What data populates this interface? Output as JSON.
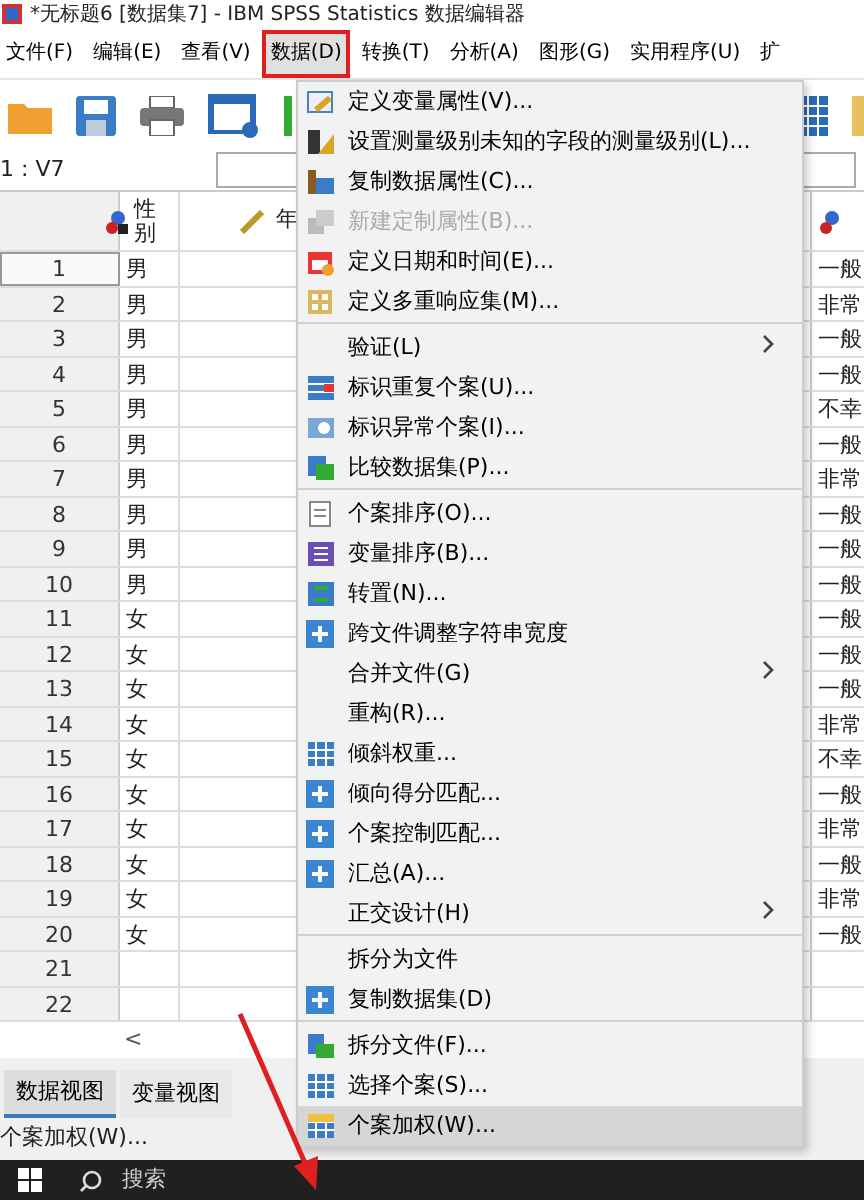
{
  "window": {
    "title": "*无标题6 [数据集7] - IBM SPSS Statistics 数据编辑器"
  },
  "menubar": [
    {
      "label": "文件(F)",
      "selected": false
    },
    {
      "label": "编辑(E)",
      "selected": false
    },
    {
      "label": "查看(V)",
      "selected": false
    },
    {
      "label": "数据(D)",
      "selected": true
    },
    {
      "label": "转换(T)",
      "selected": false
    },
    {
      "label": "分析(A)",
      "selected": false
    },
    {
      "label": "图形(G)",
      "selected": false
    },
    {
      "label": "实用程序(U)",
      "selected": false
    },
    {
      "label": "扩",
      "selected": false
    }
  ],
  "cell_ref": "1 : V7",
  "grid": {
    "columns": [
      "性别",
      "年"
    ],
    "rows": [
      {
        "row": "1",
        "col_1": "男",
        "col_last": "一般",
        "selected": true
      },
      {
        "row": "2",
        "col_1": "男",
        "col_last": "非常",
        "selected": false
      },
      {
        "row": "3",
        "col_1": "男",
        "col_last": "一般",
        "selected": false
      },
      {
        "row": "4",
        "col_1": "男",
        "col_last": "一般",
        "selected": false
      },
      {
        "row": "5",
        "col_1": "男",
        "col_last": "不幸",
        "selected": false
      },
      {
        "row": "6",
        "col_1": "男",
        "col_last": "一般",
        "selected": false
      },
      {
        "row": "7",
        "col_1": "男",
        "col_last": "非常",
        "selected": false
      },
      {
        "row": "8",
        "col_1": "男",
        "col_last": "一般",
        "selected": false
      },
      {
        "row": "9",
        "col_1": "男",
        "col_last": "一般",
        "selected": false
      },
      {
        "row": "10",
        "col_1": "男",
        "col_last": "一般",
        "selected": false
      },
      {
        "row": "11",
        "col_1": "女",
        "col_last": "一般",
        "selected": false
      },
      {
        "row": "12",
        "col_1": "女",
        "col_last": "一般",
        "selected": false
      },
      {
        "row": "13",
        "col_1": "女",
        "col_last": "一般",
        "selected": false
      },
      {
        "row": "14",
        "col_1": "女",
        "col_last": "非常",
        "selected": false
      },
      {
        "row": "15",
        "col_1": "女",
        "col_last": "不幸",
        "selected": false
      },
      {
        "row": "16",
        "col_1": "女",
        "col_last": "一般",
        "selected": false
      },
      {
        "row": "17",
        "col_1": "女",
        "col_last": "非常",
        "selected": false
      },
      {
        "row": "18",
        "col_1": "女",
        "col_last": "一般",
        "selected": false
      },
      {
        "row": "19",
        "col_1": "女",
        "col_last": "非常",
        "selected": false
      },
      {
        "row": "20",
        "col_1": "女",
        "col_last": "一般",
        "selected": false
      },
      {
        "row": "21",
        "selected": false
      },
      {
        "row": "22",
        "selected": false
      }
    ]
  },
  "scroll_arrow": "<",
  "view_tabs": [
    {
      "label": "数据视图",
      "selected": true
    },
    {
      "label": "变量视图",
      "selected": false
    }
  ],
  "status_bar": "个案加权(W)...",
  "taskbar": {
    "search": "搜索"
  },
  "data_menu": [
    {
      "label": "定义变量属性(V)...",
      "disabled": false,
      "submenu": false,
      "selected": false
    },
    {
      "label": "设置测量级别未知的字段的测量级别(L)...",
      "disabled": false,
      "submenu": false,
      "selected": false
    },
    {
      "label": "复制数据属性(C)...",
      "disabled": false,
      "submenu": false,
      "selected": false
    },
    {
      "label": "新建定制属性(B)...",
      "disabled": true,
      "submenu": false,
      "selected": false
    },
    {
      "label": "定义日期和时间(E)...",
      "disabled": false,
      "submenu": false,
      "selected": false
    },
    {
      "label": "定义多重响应集(M)...",
      "disabled": false,
      "submenu": false,
      "selected": false,
      "separator_after": true
    },
    {
      "label": "验证(L)",
      "disabled": false,
      "submenu": true,
      "selected": false
    },
    {
      "label": "标识重复个案(U)...",
      "disabled": false,
      "submenu": false,
      "selected": false
    },
    {
      "label": "标识异常个案(I)...",
      "disabled": false,
      "submenu": false,
      "selected": false
    },
    {
      "label": "比较数据集(P)...",
      "disabled": false,
      "submenu": false,
      "selected": false,
      "separator_after": true
    },
    {
      "label": "个案排序(O)...",
      "disabled": false,
      "submenu": false,
      "selected": false
    },
    {
      "label": "变量排序(B)...",
      "disabled": false,
      "submenu": false,
      "selected": false
    },
    {
      "label": "转置(N)...",
      "disabled": false,
      "submenu": false,
      "selected": false
    },
    {
      "label": "跨文件调整字符串宽度",
      "disabled": false,
      "submenu": false,
      "selected": false
    },
    {
      "label": "合并文件(G)",
      "disabled": false,
      "submenu": true,
      "selected": false
    },
    {
      "label": "重构(R)...",
      "disabled": false,
      "submenu": false,
      "selected": false
    },
    {
      "label": "倾斜权重...",
      "disabled": false,
      "submenu": false,
      "selected": false
    },
    {
      "label": "倾向得分匹配...",
      "disabled": false,
      "submenu": false,
      "selected": false
    },
    {
      "label": "个案控制匹配...",
      "disabled": false,
      "submenu": false,
      "selected": false
    },
    {
      "label": "汇总(A)...",
      "disabled": false,
      "submenu": false,
      "selected": false
    },
    {
      "label": "正交设计(H)",
      "disabled": false,
      "submenu": true,
      "selected": false,
      "separator_after": true
    },
    {
      "label": "拆分为文件",
      "disabled": false,
      "submenu": false,
      "selected": false
    },
    {
      "label": "复制数据集(D)",
      "disabled": false,
      "submenu": false,
      "selected": false,
      "separator_after": true
    },
    {
      "label": "拆分文件(F)...",
      "disabled": false,
      "submenu": false,
      "selected": false
    },
    {
      "label": "选择个案(S)...",
      "disabled": false,
      "submenu": false,
      "selected": false
    },
    {
      "label": "个案加权(W)...",
      "disabled": false,
      "submenu": false,
      "selected": true
    }
  ]
}
